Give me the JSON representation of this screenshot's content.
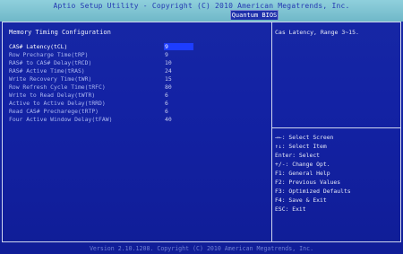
{
  "header": {
    "title": "Aptio Setup Utility - Copyright (C) 2010 American Megatrends, Inc.",
    "tab": "Quantum BIOS"
  },
  "main": {
    "section_title": "Memory Timing Configuration",
    "settings": [
      {
        "label": "CAS# Latency(tCL)",
        "value": "9",
        "selected": true
      },
      {
        "label": "Row Precharge Time(tRP)",
        "value": "9"
      },
      {
        "label": "RAS# to CAS# Delay(tRCD)",
        "value": "10"
      },
      {
        "label": "RAS# Active Time(tRAS)",
        "value": "24"
      },
      {
        "label": "Write Recovery Time(tWR)",
        "value": "15"
      },
      {
        "label": "Row Refresh Cycle Time(tRFC)",
        "value": "80"
      },
      {
        "label": "Write to Read Delay(tWTR)",
        "value": "6"
      },
      {
        "label": "Active to Active Delay(tRRD)",
        "value": "6"
      },
      {
        "label": "Read CAS# Precharege(tRTP)",
        "value": "6"
      },
      {
        "label": "Four Active Window Delay(tFAW)",
        "value": "40"
      }
    ]
  },
  "help": {
    "text": "Cas Latency, Range 3~15."
  },
  "keys": [
    "→←: Select Screen",
    "↑↓: Select Item",
    "Enter: Select",
    "+/-: Change Opt.",
    "F1: General Help",
    "F2: Previous Values",
    "F3: Optimized Defaults",
    "F4: Save & Exit",
    "ESC: Exit"
  ],
  "footer": {
    "text": "Version 2.10.1208. Copyright (C) 2010 American Megatrends, Inc."
  },
  "colors": {
    "background": "#1322a4",
    "header": "#79c1cf",
    "selected": "#1d3dff",
    "frame": "#cfd6ef"
  }
}
